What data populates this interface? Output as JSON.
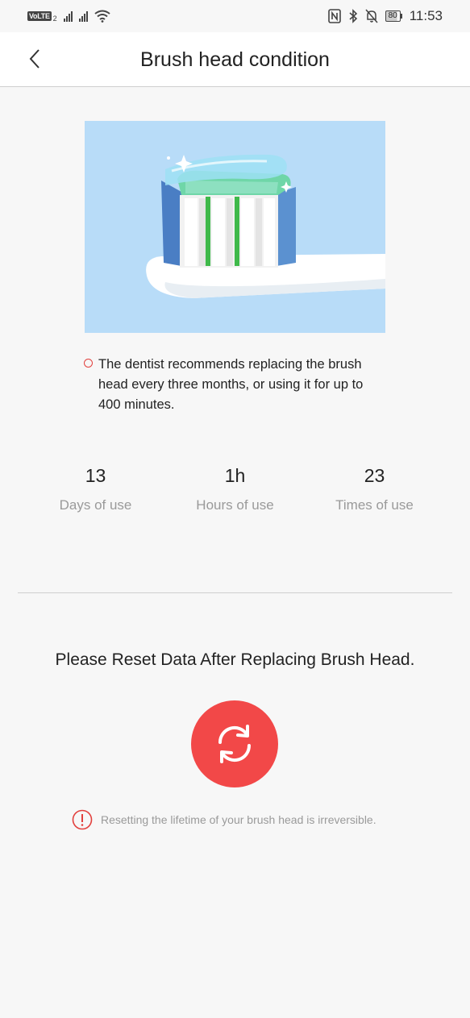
{
  "status_bar": {
    "volte": "VoLTE",
    "sim": "2",
    "battery": "80",
    "time": "11:53"
  },
  "header": {
    "title": "Brush head condition",
    "back_icon": "chevron-left-icon"
  },
  "note": {
    "text": "The dentist recommends replacing the brush head every three months, or using it for up to 400 minutes."
  },
  "stats": [
    {
      "value": "13",
      "label": "Days of use"
    },
    {
      "value": "1h",
      "label": "Hours of use"
    },
    {
      "value": "23",
      "label": "Times of use"
    }
  ],
  "reset": {
    "title": "Please Reset Data After Replacing Brush Head.",
    "icon": "refresh-icon",
    "warning": "Resetting the lifetime of your brush head is irreversible."
  },
  "colors": {
    "accent": "#f24848",
    "illustration_bg": "#b8dcf8",
    "background": "#f7f7f7"
  }
}
